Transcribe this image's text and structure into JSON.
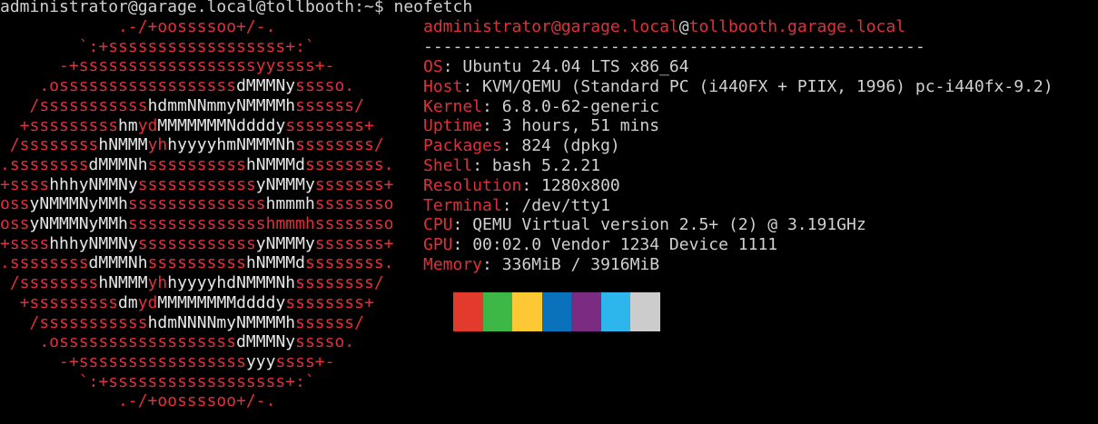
{
  "prompt": {
    "user_host": "administrator@garage.local@tollbooth",
    "path": ":~$",
    "command": " neofetch"
  },
  "logo": [
    [
      {
        "t": "            .-/+oossssoo+/-.",
        "c": "red"
      }
    ],
    [
      {
        "t": "        `:+ssssssssssssssssss+:`",
        "c": "red"
      }
    ],
    [
      {
        "t": "      -+ssssssssssssssssssyyssss+-",
        "c": "red"
      }
    ],
    [
      {
        "t": "    .ossssssssssssssssss",
        "c": "red"
      },
      {
        "t": "dMMMNy",
        "c": "white"
      },
      {
        "t": "sssso.",
        "c": "red"
      }
    ],
    [
      {
        "t": "   /sssssssssss",
        "c": "red"
      },
      {
        "t": "hdmmNNmmyNMMMMh",
        "c": "white"
      },
      {
        "t": "ssssss/",
        "c": "red"
      }
    ],
    [
      {
        "t": "  +sssssssss",
        "c": "red"
      },
      {
        "t": "hm",
        "c": "white"
      },
      {
        "t": "yd",
        "c": "red"
      },
      {
        "t": "MMMMMMMNddddy",
        "c": "white"
      },
      {
        "t": "ssssssss+",
        "c": "red"
      }
    ],
    [
      {
        "t": " /ssssssss",
        "c": "red"
      },
      {
        "t": "hNMMM",
        "c": "white"
      },
      {
        "t": "yh",
        "c": "red"
      },
      {
        "t": "hyyyyhmNMMMNh",
        "c": "white"
      },
      {
        "t": "ssssssss/",
        "c": "red"
      }
    ],
    [
      {
        "t": ".ssssssss",
        "c": "red"
      },
      {
        "t": "dMMMNh",
        "c": "white"
      },
      {
        "t": "ssssssssss",
        "c": "red"
      },
      {
        "t": "hNMMMd",
        "c": "white"
      },
      {
        "t": "ssssssss.",
        "c": "red"
      }
    ],
    [
      {
        "t": "+ssss",
        "c": "red"
      },
      {
        "t": "hhhyNMMNy",
        "c": "white"
      },
      {
        "t": "ssssssssssss",
        "c": "red"
      },
      {
        "t": "yNMMMy",
        "c": "white"
      },
      {
        "t": "sssssss+",
        "c": "red"
      }
    ],
    [
      {
        "t": "oss",
        "c": "red"
      },
      {
        "t": "yNMMMNyMMh",
        "c": "white"
      },
      {
        "t": "ssssssssssssss",
        "c": "red"
      },
      {
        "t": "hmmmh",
        "c": "white"
      },
      {
        "t": "ssssssso",
        "c": "red"
      }
    ],
    [
      {
        "t": "oss",
        "c": "red"
      },
      {
        "t": "yNMMMNyMMh",
        "c": "white"
      },
      {
        "t": "sssssssssssssshmmmhssssssso",
        "c": "red"
      }
    ],
    [
      {
        "t": "+ssss",
        "c": "red"
      },
      {
        "t": "hhhyNMMNy",
        "c": "white"
      },
      {
        "t": "ssssssssssss",
        "c": "red"
      },
      {
        "t": "yNMMMy",
        "c": "white"
      },
      {
        "t": "sssssss+",
        "c": "red"
      }
    ],
    [
      {
        "t": ".ssssssss",
        "c": "red"
      },
      {
        "t": "dMMMNh",
        "c": "white"
      },
      {
        "t": "ssssssssss",
        "c": "red"
      },
      {
        "t": "hNMMMd",
        "c": "white"
      },
      {
        "t": "ssssssss.",
        "c": "red"
      }
    ],
    [
      {
        "t": " /ssssssss",
        "c": "red"
      },
      {
        "t": "hNMMM",
        "c": "white"
      },
      {
        "t": "yh",
        "c": "red"
      },
      {
        "t": "hyyyyhdNMMMNh",
        "c": "white"
      },
      {
        "t": "ssssssss/",
        "c": "red"
      }
    ],
    [
      {
        "t": "  +sssssssss",
        "c": "red"
      },
      {
        "t": "dm",
        "c": "white"
      },
      {
        "t": "yd",
        "c": "red"
      },
      {
        "t": "MMMMMMMMddddy",
        "c": "white"
      },
      {
        "t": "ssssssss+",
        "c": "red"
      }
    ],
    [
      {
        "t": "   /sssssssssss",
        "c": "red"
      },
      {
        "t": "hdmNNNNmyNMMMMh",
        "c": "white"
      },
      {
        "t": "ssssss/",
        "c": "red"
      }
    ],
    [
      {
        "t": "    .ossssssssssssssssss",
        "c": "red"
      },
      {
        "t": "dMMMNy",
        "c": "white"
      },
      {
        "t": "sssso.",
        "c": "red"
      }
    ],
    [
      {
        "t": "      -+sssssssssssssssss",
        "c": "red"
      },
      {
        "t": "yyy",
        "c": "white"
      },
      {
        "t": "ssss+-",
        "c": "red"
      }
    ],
    [
      {
        "t": "        `:+ssssssssssssssssss+:`",
        "c": "red"
      }
    ],
    [
      {
        "t": "            .-/+oossssoo+/-.",
        "c": "red"
      }
    ]
  ],
  "info": {
    "title_user": "administrator@garage.local",
    "title_at": "@",
    "title_host": "tollbooth.garage.local",
    "separator": "---------------------------------------------------",
    "fields": [
      {
        "key": "OS",
        "value": ": Ubuntu 24.04 LTS x86_64"
      },
      {
        "key": "Host",
        "value": ": KVM/QEMU (Standard PC (i440FX + PIIX, 1996) pc-i440fx-9.2)"
      },
      {
        "key": "Kernel",
        "value": ": 6.8.0-62-generic"
      },
      {
        "key": "Uptime",
        "value": ": 3 hours, 51 mins"
      },
      {
        "key": "Packages",
        "value": ": 824 (dpkg)"
      },
      {
        "key": "Shell",
        "value": ": bash 5.2.21"
      },
      {
        "key": "Resolution",
        "value": ": 1280x800"
      },
      {
        "key": "Terminal",
        "value": ": /dev/tty1"
      },
      {
        "key": "CPU",
        "value": ": QEMU Virtual version 2.5+ (2) @ 3.191GHz"
      },
      {
        "key": "GPU",
        "value": ": 00:02.0 Vendor 1234 Device 1111"
      },
      {
        "key": "Memory",
        "value": ": 336MiB / 3916MiB"
      }
    ]
  },
  "colors": {
    "accent": "#e0303a",
    "text": "#d0d0d0",
    "logo_white": "#e8e8e8",
    "background": "#000000"
  },
  "palette": [
    "#e23b2e",
    "#3db847",
    "#fcc934",
    "#0a72bb",
    "#7b2c82",
    "#2cb6eb",
    "#cccccc"
  ]
}
